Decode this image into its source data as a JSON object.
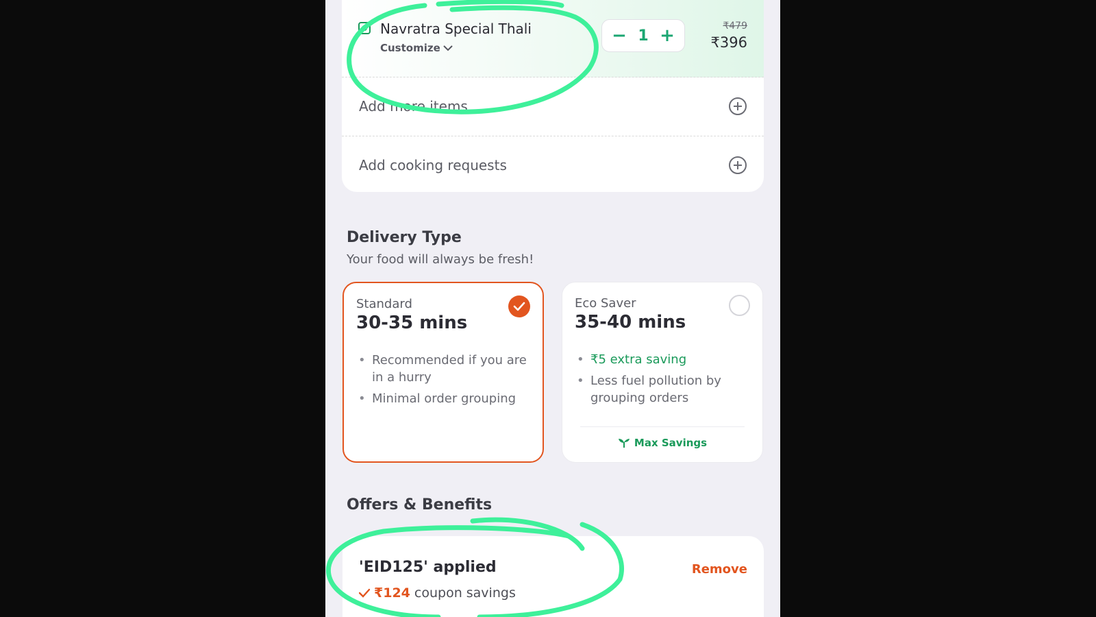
{
  "cart": {
    "item_name": "Navratra Special Thali",
    "customize_label": "Customize",
    "quantity": "1",
    "minus_symbol": "−",
    "plus_symbol": "+",
    "original_price": "₹479",
    "price": "₹396",
    "add_more_label": "Add more items",
    "cooking_label": "Add cooking requests"
  },
  "delivery": {
    "title": "Delivery Type",
    "subtitle": "Your food will always be fresh!",
    "standard": {
      "type": "Standard",
      "time": "30-35 mins",
      "selected": true,
      "points": [
        "Recommended if you are in a hurry",
        "Minimal order grouping"
      ]
    },
    "eco": {
      "type": "Eco Saver",
      "time": "35-40 mins",
      "selected": false,
      "points": [
        "₹5 extra saving",
        "Less fuel pollution by grouping orders"
      ],
      "badge": "Max Savings"
    }
  },
  "offers": {
    "title": "Offers & Benefits",
    "coupon_applied": "'EID125' applied",
    "savings_amount": "₹124",
    "savings_text": "coupon savings",
    "remove_label": "Remove"
  },
  "colors": {
    "accent": "#e2551f",
    "green": "#1ba672",
    "highlight_marker": "#3ef09a"
  },
  "icons": [
    "veg-indicator-icon",
    "chevron-down-icon",
    "plus-circle-icon",
    "checkmark-icon",
    "sprout-icon"
  ]
}
